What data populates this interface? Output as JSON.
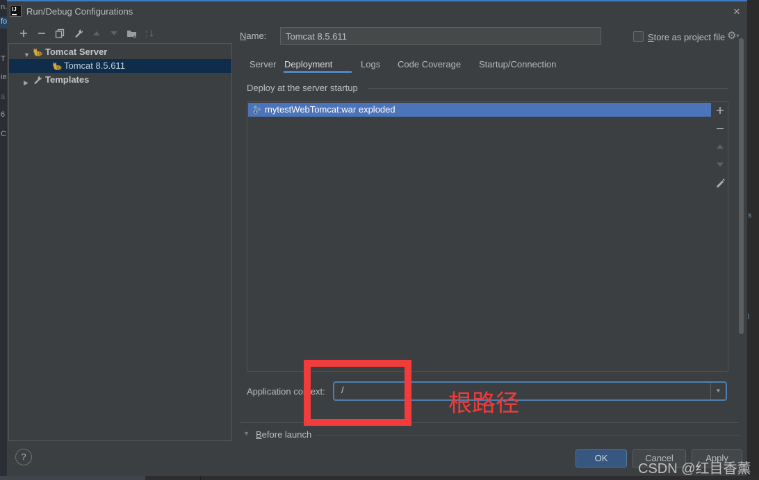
{
  "window": {
    "title": "Run/Debug Configurations",
    "close_glyph": "×"
  },
  "left_toolbar": {
    "icons": [
      {
        "name": "add-icon"
      },
      {
        "name": "remove-icon"
      },
      {
        "name": "copy-icon"
      },
      {
        "name": "edit-templates-icon"
      },
      {
        "name": "move-up-icon",
        "disabled": true
      },
      {
        "name": "move-down-icon",
        "disabled": true
      },
      {
        "name": "new-folder-icon"
      },
      {
        "name": "sort-alphabetically-icon",
        "disabled": true
      }
    ]
  },
  "tree": {
    "items": [
      {
        "label": "Tomcat Server",
        "icon": "tomcat-icon",
        "state": "expanded",
        "bold": true
      },
      {
        "label": "Tomcat 8.5.611",
        "icon": "tomcat-icon",
        "selected": true
      },
      {
        "label": "Templates",
        "icon": "wrench-icon",
        "state": "collapsed",
        "bold": true
      }
    ]
  },
  "name_row": {
    "label_mnemonic": "N",
    "label_rest": "ame:",
    "value": "Tomcat 8.5.611",
    "store_mnemonic": "S",
    "store_rest": "tore as project file",
    "store_checked": false
  },
  "tabs": {
    "items": [
      "Server",
      "Deployment",
      "Logs",
      "Code Coverage",
      "Startup/Connection"
    ],
    "selected": "Deployment"
  },
  "deployment_tab": {
    "section_title": "Deploy at the server startup",
    "artifacts": [
      {
        "label": "mytestWebTomcat:war exploded",
        "icon": "artifact-exploded-war-icon",
        "selected": true
      }
    ],
    "panel_icons": [
      {
        "name": "add-icon"
      },
      {
        "name": "remove-icon"
      },
      {
        "name": "move-up-icon",
        "disabled": true
      },
      {
        "name": "move-down-icon",
        "disabled": true
      },
      {
        "name": "edit-icon"
      }
    ],
    "app_context": {
      "label": "Application context:",
      "value": "/"
    }
  },
  "before_launch": {
    "mnemonic": "B",
    "rest": "efore launch"
  },
  "footer": {
    "help": "?",
    "ok": "OK",
    "cancel": "Cancel",
    "apply": "Apply"
  },
  "annotations": {
    "label": "根路径"
  },
  "watermark": "CSDN @红目香薰",
  "background": {
    "left_fragments": [
      "n.",
      "fo",
      "T",
      "ie",
      "a",
      "6",
      "C"
    ],
    "right_fragments": [
      "s",
      "l"
    ]
  },
  "colors": {
    "dialog_bg": "#3c3f41",
    "accent_blue": "#4a88c7",
    "list_selection": "#4b74ba",
    "tree_selection": "#0f2d4a",
    "ok_button": "#365880",
    "annotation_red": "#f23b3b",
    "border": "#515151",
    "text": "#bbbbbb"
  }
}
